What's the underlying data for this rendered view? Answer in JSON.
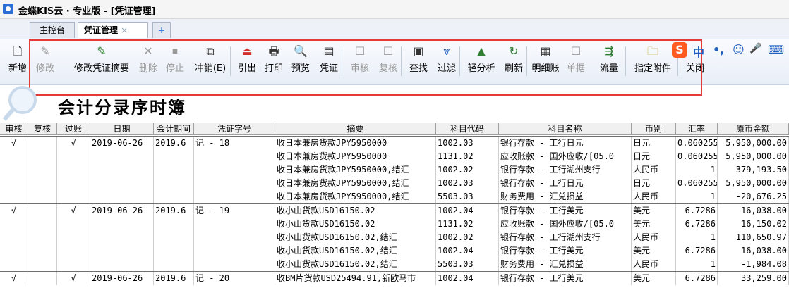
{
  "window": {
    "title": "金蝶KIS云 · 专业版 - [凭证管理]"
  },
  "tabs": [
    {
      "label": "主控台"
    },
    {
      "label": "凭证管理",
      "close": "×"
    },
    {
      "label": "+"
    }
  ],
  "toolbar": {
    "buttons": [
      {
        "label": "新增",
        "icon": "new-doc-icon",
        "disabled": false
      },
      {
        "label": "修改",
        "icon": "edit-icon",
        "disabled": true
      },
      {
        "label": "修改凭证摘要",
        "icon": "edit-summary-icon",
        "disabled": false
      },
      {
        "label": "删除",
        "icon": "delete-icon",
        "disabled": true
      },
      {
        "label": "停止",
        "icon": "stop-icon",
        "disabled": true
      },
      {
        "label": "冲销(E)",
        "icon": "reverse-icon",
        "disabled": false
      },
      {
        "label": "引出",
        "icon": "export-icon",
        "disabled": false
      },
      {
        "label": "打印",
        "icon": "print-icon",
        "disabled": false
      },
      {
        "label": "预览",
        "icon": "preview-icon",
        "disabled": false
      },
      {
        "label": "凭证",
        "icon": "voucher-icon",
        "disabled": false
      },
      {
        "label": "审核",
        "icon": "audit-icon",
        "disabled": true
      },
      {
        "label": "复核",
        "icon": "review-icon",
        "disabled": true
      },
      {
        "label": "查找",
        "icon": "find-icon",
        "disabled": false
      },
      {
        "label": "过滤",
        "icon": "filter-icon",
        "disabled": false
      },
      {
        "label": "轻分析",
        "icon": "analysis-icon",
        "disabled": false
      },
      {
        "label": "刷新",
        "icon": "refresh-icon",
        "disabled": false
      },
      {
        "label": "明细账",
        "icon": "ledger-icon",
        "disabled": false
      },
      {
        "label": "单据",
        "icon": "document-icon",
        "disabled": true
      },
      {
        "label": "流量",
        "icon": "flow-icon",
        "disabled": false
      },
      {
        "label": "指定附件",
        "icon": "folder-icon",
        "disabled": false
      },
      {
        "label": "关闭",
        "icon": "close-icon",
        "disabled": false
      }
    ]
  },
  "ime": {
    "logo": "S",
    "items": [
      "中",
      "•,",
      "☺",
      "🎤",
      "⌨"
    ]
  },
  "report": {
    "title": "会计分录序时簿"
  },
  "grid": {
    "columns": [
      "审核",
      "复核",
      "过账",
      "日期",
      "会计期间",
      "凭证字号",
      "摘要",
      "科目代码",
      "科目名称",
      "币别",
      "汇率",
      "原币金额"
    ],
    "groups": [
      {
        "audit": "√",
        "review": "",
        "posted": "√",
        "date": "2019-06-26",
        "period": "2019.6",
        "voucher_no": "记 - 18",
        "lines": [
          {
            "summary": "收日本兼房货款JPY5950000",
            "code": "1002.03",
            "account": "银行存款 - 工行日元",
            "currency": "日元",
            "rate": "0.060255",
            "amount": "5,950,000.00"
          },
          {
            "summary": "收日本兼房货款JPY5950000",
            "code": "1131.02",
            "account": "应收账款 - 国外应收/[05.0",
            "currency": "日元",
            "rate": "0.060255",
            "amount": "5,950,000.00"
          },
          {
            "summary": "收日本兼房货款JPY5950000,结汇",
            "code": "1002.02",
            "account": "银行存款 - 工行湖州支行",
            "currency": "人民币",
            "rate": "1",
            "amount": "379,193.50"
          },
          {
            "summary": "收日本兼房货款JPY5950000,结汇",
            "code": "1002.03",
            "account": "银行存款 - 工行日元",
            "currency": "日元",
            "rate": "0.060255",
            "amount": "5,950,000.00"
          },
          {
            "summary": "收日本兼房货款JPY5950000,结汇",
            "code": "5503.03",
            "account": "财务费用 - 汇兑损益",
            "currency": "人民币",
            "rate": "1",
            "amount": "-20,676.25"
          }
        ]
      },
      {
        "audit": "√",
        "review": "",
        "posted": "√",
        "date": "2019-06-26",
        "period": "2019.6",
        "voucher_no": "记 - 19",
        "lines": [
          {
            "summary": "收小山货款USD16150.02",
            "code": "1002.04",
            "account": "银行存款 - 工行美元",
            "currency": "美元",
            "rate": "6.7286",
            "amount": "16,038.00"
          },
          {
            "summary": "收小山货款USD16150.02",
            "code": "1131.02",
            "account": "应收账款 - 国外应收/[05.0",
            "currency": "美元",
            "rate": "6.7286",
            "amount": "16,150.02"
          },
          {
            "summary": "收小山货款USD16150.02,结汇",
            "code": "1002.02",
            "account": "银行存款 - 工行湖州支行",
            "currency": "人民币",
            "rate": "1",
            "amount": "110,650.97"
          },
          {
            "summary": "收小山货款USD16150.02,结汇",
            "code": "1002.04",
            "account": "银行存款 - 工行美元",
            "currency": "美元",
            "rate": "6.7286",
            "amount": "16,038.00"
          },
          {
            "summary": "收小山货款USD16150.02,结汇",
            "code": "5503.03",
            "account": "财务费用 - 汇兑损益",
            "currency": "人民币",
            "rate": "1",
            "amount": "-1,984.08"
          }
        ]
      },
      {
        "audit": "√",
        "review": "",
        "posted": "√",
        "date": "2019-06-26",
        "period": "2019.6",
        "voucher_no": "记 - 20",
        "lines": [
          {
            "summary": "收BM片货款USD25494.91,新欧马市",
            "code": "1002.04",
            "account": "银行存款 - 工行美元",
            "currency": "美元",
            "rate": "6.7286",
            "amount": "33,259.00"
          }
        ]
      }
    ]
  }
}
